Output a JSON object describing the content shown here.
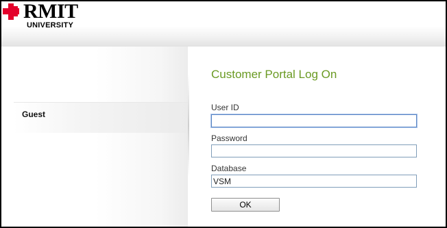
{
  "brand": {
    "name": "RMIT",
    "subtitle": "UNIVERSITY",
    "accent_color": "#e4002b",
    "logo_icon": "rmit-pixel-logo-icon"
  },
  "sidebar": {
    "items": [
      {
        "label": "Guest"
      }
    ]
  },
  "login": {
    "title": "Customer Portal Log On",
    "title_color": "#6a9a23",
    "user_id": {
      "label": "User ID",
      "value": ""
    },
    "password": {
      "label": "Password",
      "value": ""
    },
    "database": {
      "label": "Database",
      "value": "VSM"
    },
    "submit_label": "OK"
  }
}
